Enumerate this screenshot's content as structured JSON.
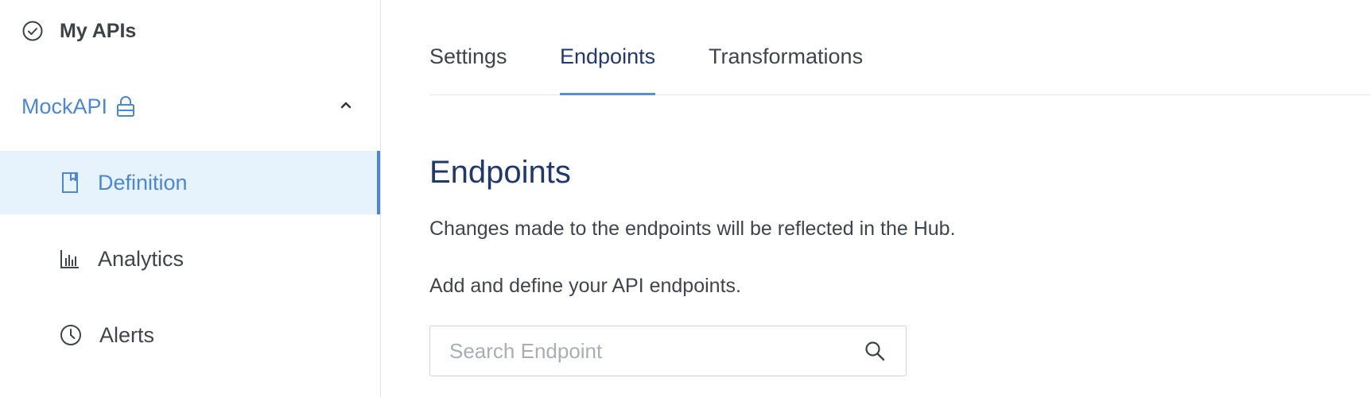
{
  "sidebar": {
    "my_apis_label": "My APIs",
    "api_name": "MockAPI",
    "items": [
      {
        "label": "Definition",
        "icon": "book-icon",
        "active": true
      },
      {
        "label": "Analytics",
        "icon": "bar-chart-icon",
        "active": false
      },
      {
        "label": "Alerts",
        "icon": "clock-icon",
        "active": false
      }
    ]
  },
  "tabs": [
    {
      "label": "Settings",
      "active": false
    },
    {
      "label": "Endpoints",
      "active": true
    },
    {
      "label": "Transformations",
      "active": false
    }
  ],
  "main": {
    "title": "Endpoints",
    "description_1": "Changes made to the endpoints will be reflected in the Hub.",
    "description_2": "Add and define your API endpoints.",
    "search": {
      "placeholder": "Search Endpoint",
      "value": ""
    }
  },
  "colors": {
    "accent": "#4b87d2",
    "title": "#22386b",
    "active_bg": "#e7f3fc"
  }
}
